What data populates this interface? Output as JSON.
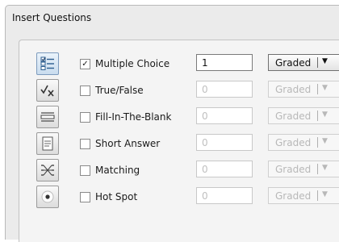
{
  "dialog": {
    "title": "Insert Questions"
  },
  "questions": [
    {
      "icon": "multiple-choice-icon",
      "label": "Multiple Choice",
      "checked": true,
      "count": "1",
      "grading": "Graded",
      "enabled": true
    },
    {
      "icon": "true-false-icon",
      "label": "True/False",
      "checked": false,
      "count": "0",
      "grading": "Graded",
      "enabled": false
    },
    {
      "icon": "fill-in-the-blank-icon",
      "label": "Fill-In-The-Blank",
      "checked": false,
      "count": "0",
      "grading": "Graded",
      "enabled": false
    },
    {
      "icon": "short-answer-icon",
      "label": "Short Answer",
      "checked": false,
      "count": "0",
      "grading": "Graded",
      "enabled": false
    },
    {
      "icon": "matching-icon",
      "label": "Matching",
      "checked": false,
      "count": "0",
      "grading": "Graded",
      "enabled": false
    },
    {
      "icon": "hot-spot-icon",
      "label": "Hot Spot",
      "checked": false,
      "count": "0",
      "grading": "Graded",
      "enabled": false
    }
  ],
  "checkmark_glyph": "✓",
  "dropdown_arrow_glyph": "▼"
}
